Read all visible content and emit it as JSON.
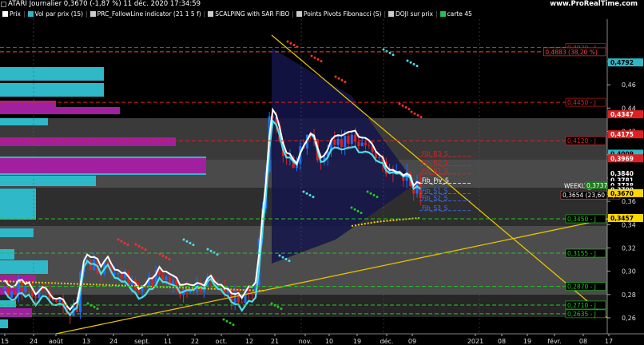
{
  "header": {
    "title": "ATARI Journalier 0,3670 (-1,87 %) 11 déc. 2020 17:34:59",
    "brand": "www.ProRealTime.com"
  },
  "legend": [
    {
      "label": "Prix",
      "color": "#ffffff"
    },
    {
      "label": "Vol par prix (15)",
      "color": "#2fb8c8"
    },
    {
      "label": "PRC_FollowLine indicator (21 1 5 f)",
      "color": "#cccccc"
    },
    {
      "label": "SCALPING with SAR FIBO",
      "color": "#cccccc"
    },
    {
      "label": "Points Pivots Fibonacci (S)",
      "color": "#cccccc"
    },
    {
      "label": "DOJI sur prix",
      "color": "#cccccc"
    },
    {
      "label": "carte 45",
      "color": "#22c060"
    }
  ],
  "y_axis": {
    "ticks": [
      "0,48",
      "0,46",
      "0,44",
      "0,42",
      "0,40",
      "0,38",
      "0,36",
      "0,34",
      "0,32",
      "0,30",
      "0,28",
      "0,26"
    ]
  },
  "x_axis": {
    "labels": [
      "15",
      "24",
      "août",
      "13",
      "24",
      "sept.",
      "11",
      "22",
      "oct.",
      "12",
      "21",
      "nov.",
      "10",
      "19",
      "déc.",
      "09",
      "2021",
      "08",
      "19",
      "févr.",
      "08",
      "17"
    ]
  },
  "levels": [
    {
      "value": 0.492,
      "label": "0,4920 - J",
      "color": "#e02020",
      "style": "dash"
    },
    {
      "value": 0.4883,
      "label": "0,4883 (38,20 %)",
      "color": "#ff4040",
      "style": "dash"
    },
    {
      "value": 0.445,
      "label": "0,4450 - J",
      "color": "#e02020",
      "style": "dash"
    },
    {
      "value": 0.412,
      "label": "0,4120 - J",
      "color": "#e02020",
      "style": "dash"
    },
    {
      "value": 0.345,
      "label": "0,3450 - J",
      "color": "#22c822",
      "style": "dash"
    },
    {
      "value": 0.3155,
      "label": "0,3155 - J",
      "color": "#22c822",
      "style": "dash"
    },
    {
      "value": 0.287,
      "label": "0,2870 - J",
      "color": "#22c822",
      "style": "dash"
    },
    {
      "value": 0.271,
      "label": "0,2710 - J",
      "color": "#22c822",
      "style": "dash"
    },
    {
      "value": 0.2635,
      "label": "0,2635 - J",
      "color": "#22c822",
      "style": "dash"
    }
  ],
  "right_tags": [
    {
      "value": 0.4792,
      "label": "0,4792",
      "bg": "#2fb8c8",
      "fg": "#000000"
    },
    {
      "value": 0.4347,
      "label": "0,4347",
      "bg": "#e02020",
      "fg": "#ffffff"
    },
    {
      "value": 0.4175,
      "label": "0,4175",
      "bg": "#e02020",
      "fg": "#ffffff"
    },
    {
      "value": 0.4009,
      "label": "0,4009",
      "bg": "#2fb8c8",
      "fg": "#000000"
    },
    {
      "value": 0.3969,
      "label": "0,3969",
      "bg": "#e02020",
      "fg": "#ffffff"
    },
    {
      "value": 0.384,
      "label": "0,3840",
      "bg": "#000000",
      "fg": "#ffffff"
    },
    {
      "value": 0.3781,
      "label": "0,3781",
      "bg": "#000000",
      "fg": "#ffffff"
    },
    {
      "value": 0.3738,
      "label": "0,3738",
      "bg": "#000000",
      "fg": "#ffffff"
    },
    {
      "value": 0.37,
      "label": "0,3700",
      "bg": "#000000",
      "fg": "#ffffff"
    },
    {
      "value": 0.367,
      "label": "0,3670",
      "bg": "#ffd700",
      "fg": "#000000"
    },
    {
      "value": 0.3457,
      "label": "0,3457",
      "bg": "#ffd700",
      "fg": "#000000"
    }
  ],
  "pivot_labels": [
    {
      "value": 0.3985,
      "label": "Fib_R3_S",
      "color": "#e02020"
    },
    {
      "value": 0.3905,
      "label": "Fib_R2_S",
      "color": "#e02020"
    },
    {
      "value": 0.3835,
      "label": "Fib_R1_S",
      "color": "#e02020"
    },
    {
      "value": 0.3755,
      "label": "Fib_Piv_S",
      "color": "#ffffff"
    },
    {
      "value": 0.3665,
      "label": "Fib_S1_S",
      "color": "#4070ff"
    },
    {
      "value": 0.3605,
      "label": "Fib_S2_S",
      "color": "#4070ff"
    },
    {
      "value": 0.352,
      "label": "Fib_S3_S",
      "color": "#4070ff"
    }
  ],
  "misc_labels": {
    "weekly": "WEEKLY_0,3700",
    "fib_pct": "0,3654 (23,60 %)",
    "green_tag": "0,3737"
  },
  "colors": {
    "up": "#1e6fff",
    "down": "#e02020",
    "volume_cyan": "#2fb8c8",
    "volume_magenta": "#a020a0",
    "trend": "#e6c200",
    "followline": "#4be0e8",
    "white_line": "#ffffff"
  }
}
